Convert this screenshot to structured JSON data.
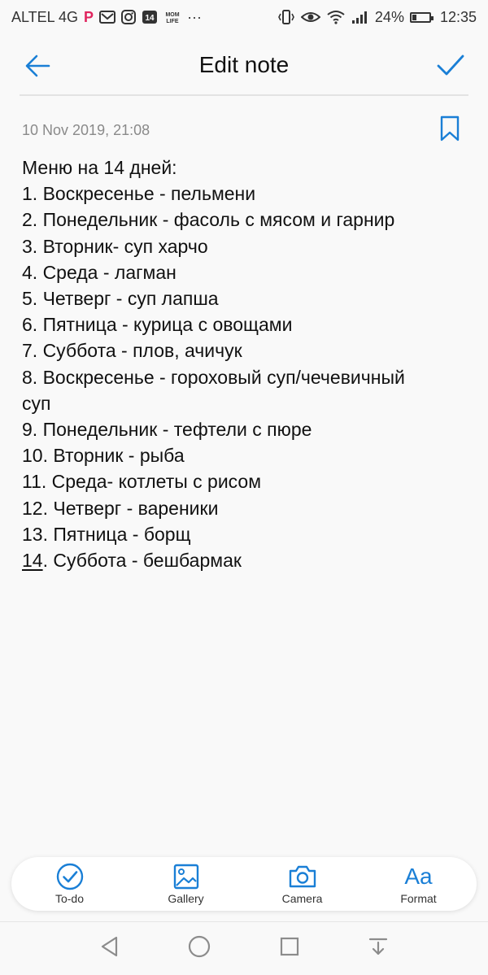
{
  "status_bar": {
    "carrier": "ALTEL 4G",
    "battery": "24%",
    "time": "12:35",
    "icons": [
      "pin-icon",
      "gmail-icon",
      "instagram-icon",
      "notification-14-icon",
      "momlife-icon",
      "more-icon",
      "vibrate-icon",
      "eye-icon",
      "wifi-icon",
      "signal-icon",
      "battery-icon"
    ],
    "notification_count": "14",
    "momlife_label": "MOM LIFE",
    "more": "···"
  },
  "header": {
    "title": "Edit note"
  },
  "note": {
    "timestamp": "10 Nov 2019, 21:08",
    "lines": [
      "Меню на 14 дней:",
      "1. Воскресенье - пельмени",
      "2. Понедельник - фасоль с мясом и гарнир",
      "3. Вторник- суп харчо",
      "4. Среда - лагман",
      "5. Четверг - суп лапша",
      "6. Пятница - курица с овощами",
      "7. Суббота - плов, ачичук",
      "8. Воскресенье - гороховый суп/чечевичный",
      "суп",
      "9. Понедельник - тефтели с пюре",
      "10. Вторник - рыба",
      "11. Среда- котлеты с рисом",
      "12. Четверг - вареники",
      "13. Пятница - борщ"
    ],
    "last_line_number": "14",
    "last_line_rest": ". Суббота - бешбармак"
  },
  "toolbar": {
    "todo_label": "To-do",
    "gallery_label": "Gallery",
    "camera_label": "Camera",
    "format_label": "Format",
    "format_glyph": "Aa"
  },
  "colors": {
    "accent": "#1a7fd6",
    "background": "#f9f9f9",
    "timestamp": "#8a8a8a"
  }
}
